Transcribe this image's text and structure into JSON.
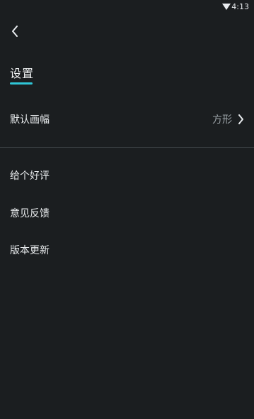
{
  "status_bar": {
    "time": "4:13",
    "wifi_icon": "wifi-icon"
  },
  "header": {
    "back_icon": "back-arrow-icon",
    "title": "设置",
    "accent_color": "#2fc6d6"
  },
  "settings": {
    "canvas_size": {
      "label": "默认画幅",
      "value": "方形",
      "chevron_icon": "chevron-right-icon"
    }
  },
  "menu": {
    "items": [
      {
        "label": "给个好评"
      },
      {
        "label": "意见反馈"
      },
      {
        "label": "版本更新"
      }
    ]
  }
}
